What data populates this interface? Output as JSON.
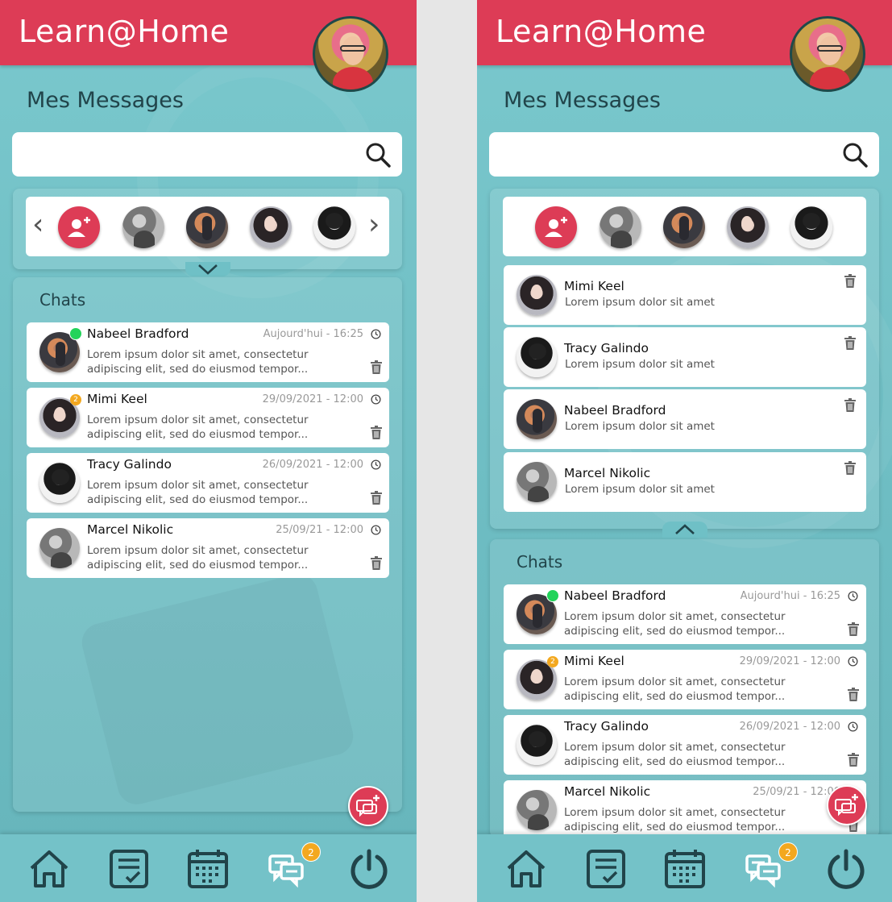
{
  "app": {
    "logo": "Learn@Home"
  },
  "page": {
    "title": "Mes Messages"
  },
  "search": {
    "placeholder": "",
    "value": ""
  },
  "chats": {
    "title": "Chats",
    "items": [
      {
        "name": "Nabeel Bradford",
        "time": "Aujourd'hui - 16:25",
        "preview": "Lorem ipsum dolor sit amet, consectetur adipiscing elit, sed do eiusmod tempor...",
        "badge": "online"
      },
      {
        "name": "Mimi Keel",
        "time": "29/09/2021 - 12:00",
        "preview": "Lorem ipsum dolor sit amet, consectetur adipiscing elit, sed do eiusmod tempor...",
        "badge": "2"
      },
      {
        "name": "Tracy Galindo",
        "time": "26/09/2021 - 12:00",
        "preview": "Lorem ipsum dolor sit amet, consectetur adipiscing elit, sed do eiusmod tempor...",
        "badge": ""
      },
      {
        "name": "Marcel Nikolic",
        "time": "25/09/21 - 12:00",
        "preview": "Lorem ipsum dolor sit amet, consectetur adipiscing elit, sed do eiusmod tempor...",
        "badge": ""
      }
    ]
  },
  "contacts_expanded": {
    "items": [
      {
        "name": "Mimi Keel",
        "preview": "Lorem ipsum dolor sit amet"
      },
      {
        "name": "Tracy Galindo",
        "preview": "Lorem ipsum dolor sit amet"
      },
      {
        "name": "Nabeel Bradford",
        "preview": "Lorem ipsum dolor sit amet"
      },
      {
        "name": "Marcel Nikolic",
        "preview": "Lorem ipsum dolor sit amet"
      }
    ]
  },
  "nav": {
    "messages_badge": "2"
  },
  "icons": {
    "search": "search-icon",
    "add_user": "add-user-icon",
    "trash": "trash-icon",
    "clock": "clock-icon",
    "home": "home-icon",
    "tasks": "tasks-icon",
    "calendar": "calendar-icon",
    "messages": "messages-icon",
    "power": "power-icon",
    "new_chat": "new-chat-icon",
    "arrow_left": "chevron-left-icon",
    "arrow_right": "chevron-right-icon",
    "collapse": "chevron-down-icon",
    "expand": "chevron-up-icon"
  },
  "colors": {
    "brand": "#dd3c56",
    "background": "#72c1c7",
    "badge": "#f3a81f",
    "online": "#22d35a",
    "text_dark": "#21444a"
  }
}
